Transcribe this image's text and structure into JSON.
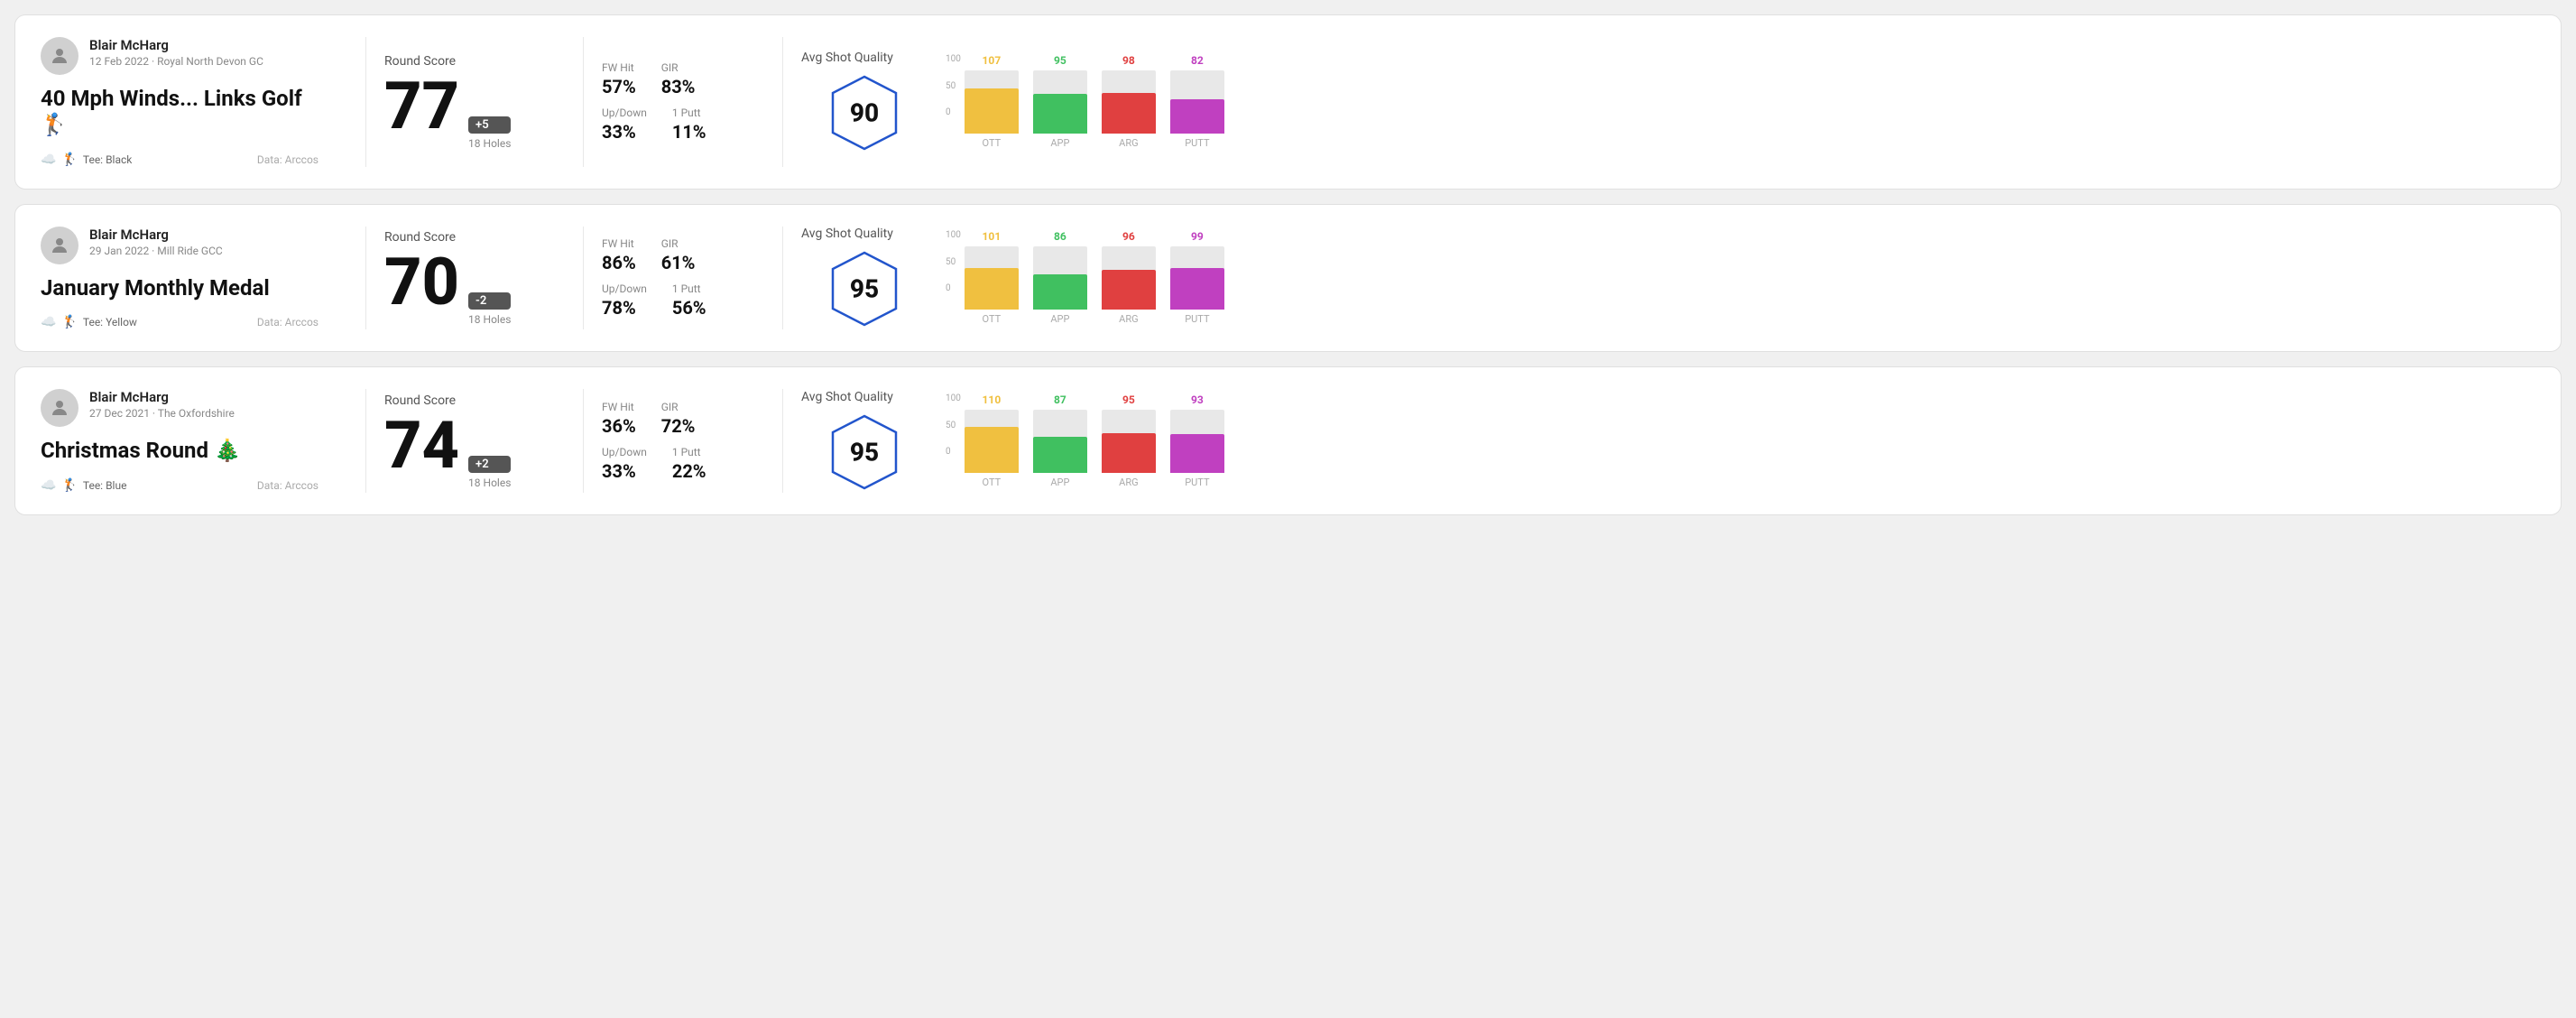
{
  "rounds": [
    {
      "id": "round1",
      "user": {
        "name": "Blair McHarg",
        "date": "12 Feb 2022",
        "course": "Royal North Devon GC"
      },
      "title": "40 Mph Winds... Links Golf 🏌️",
      "tee": "Black",
      "data_source": "Data: Arccos",
      "score": {
        "label": "Round Score",
        "number": "77",
        "diff": "+5",
        "holes": "18 Holes"
      },
      "stats": {
        "fw_hit_label": "FW Hit",
        "fw_hit_value": "57%",
        "gir_label": "GIR",
        "gir_value": "83%",
        "up_down_label": "Up/Down",
        "up_down_value": "33%",
        "one_putt_label": "1 Putt",
        "one_putt_value": "11%"
      },
      "quality": {
        "label": "Avg Shot Quality",
        "score": "90"
      },
      "chart": {
        "ott": {
          "value": 107,
          "pct": 72
        },
        "app": {
          "value": 95,
          "pct": 63
        },
        "arg": {
          "value": 98,
          "pct": 65
        },
        "putt": {
          "value": 82,
          "pct": 55
        }
      }
    },
    {
      "id": "round2",
      "user": {
        "name": "Blair McHarg",
        "date": "29 Jan 2022",
        "course": "Mill Ride GCC"
      },
      "title": "January Monthly Medal",
      "tee": "Yellow",
      "data_source": "Data: Arccos",
      "score": {
        "label": "Round Score",
        "number": "70",
        "diff": "-2",
        "holes": "18 Holes"
      },
      "stats": {
        "fw_hit_label": "FW Hit",
        "fw_hit_value": "86%",
        "gir_label": "GIR",
        "gir_value": "61%",
        "up_down_label": "Up/Down",
        "up_down_value": "78%",
        "one_putt_label": "1 Putt",
        "one_putt_value": "56%"
      },
      "quality": {
        "label": "Avg Shot Quality",
        "score": "95"
      },
      "chart": {
        "ott": {
          "value": 101,
          "pct": 67
        },
        "app": {
          "value": 86,
          "pct": 57
        },
        "arg": {
          "value": 96,
          "pct": 64
        },
        "putt": {
          "value": 99,
          "pct": 66
        }
      }
    },
    {
      "id": "round3",
      "user": {
        "name": "Blair McHarg",
        "date": "27 Dec 2021",
        "course": "The Oxfordshire"
      },
      "title": "Christmas Round 🎄",
      "tee": "Blue",
      "data_source": "Data: Arccos",
      "score": {
        "label": "Round Score",
        "number": "74",
        "diff": "+2",
        "holes": "18 Holes"
      },
      "stats": {
        "fw_hit_label": "FW Hit",
        "fw_hit_value": "36%",
        "gir_label": "GIR",
        "gir_value": "72%",
        "up_down_label": "Up/Down",
        "up_down_value": "33%",
        "one_putt_label": "1 Putt",
        "one_putt_value": "22%"
      },
      "quality": {
        "label": "Avg Shot Quality",
        "score": "95"
      },
      "chart": {
        "ott": {
          "value": 110,
          "pct": 73
        },
        "app": {
          "value": 87,
          "pct": 58
        },
        "arg": {
          "value": 95,
          "pct": 63
        },
        "putt": {
          "value": 93,
          "pct": 62
        }
      }
    }
  ],
  "labels": {
    "ott": "OTT",
    "app": "APP",
    "arg": "ARG",
    "putt": "PUTT",
    "tee_prefix": "Tee:",
    "data_prefix": "Data: Arccos"
  }
}
